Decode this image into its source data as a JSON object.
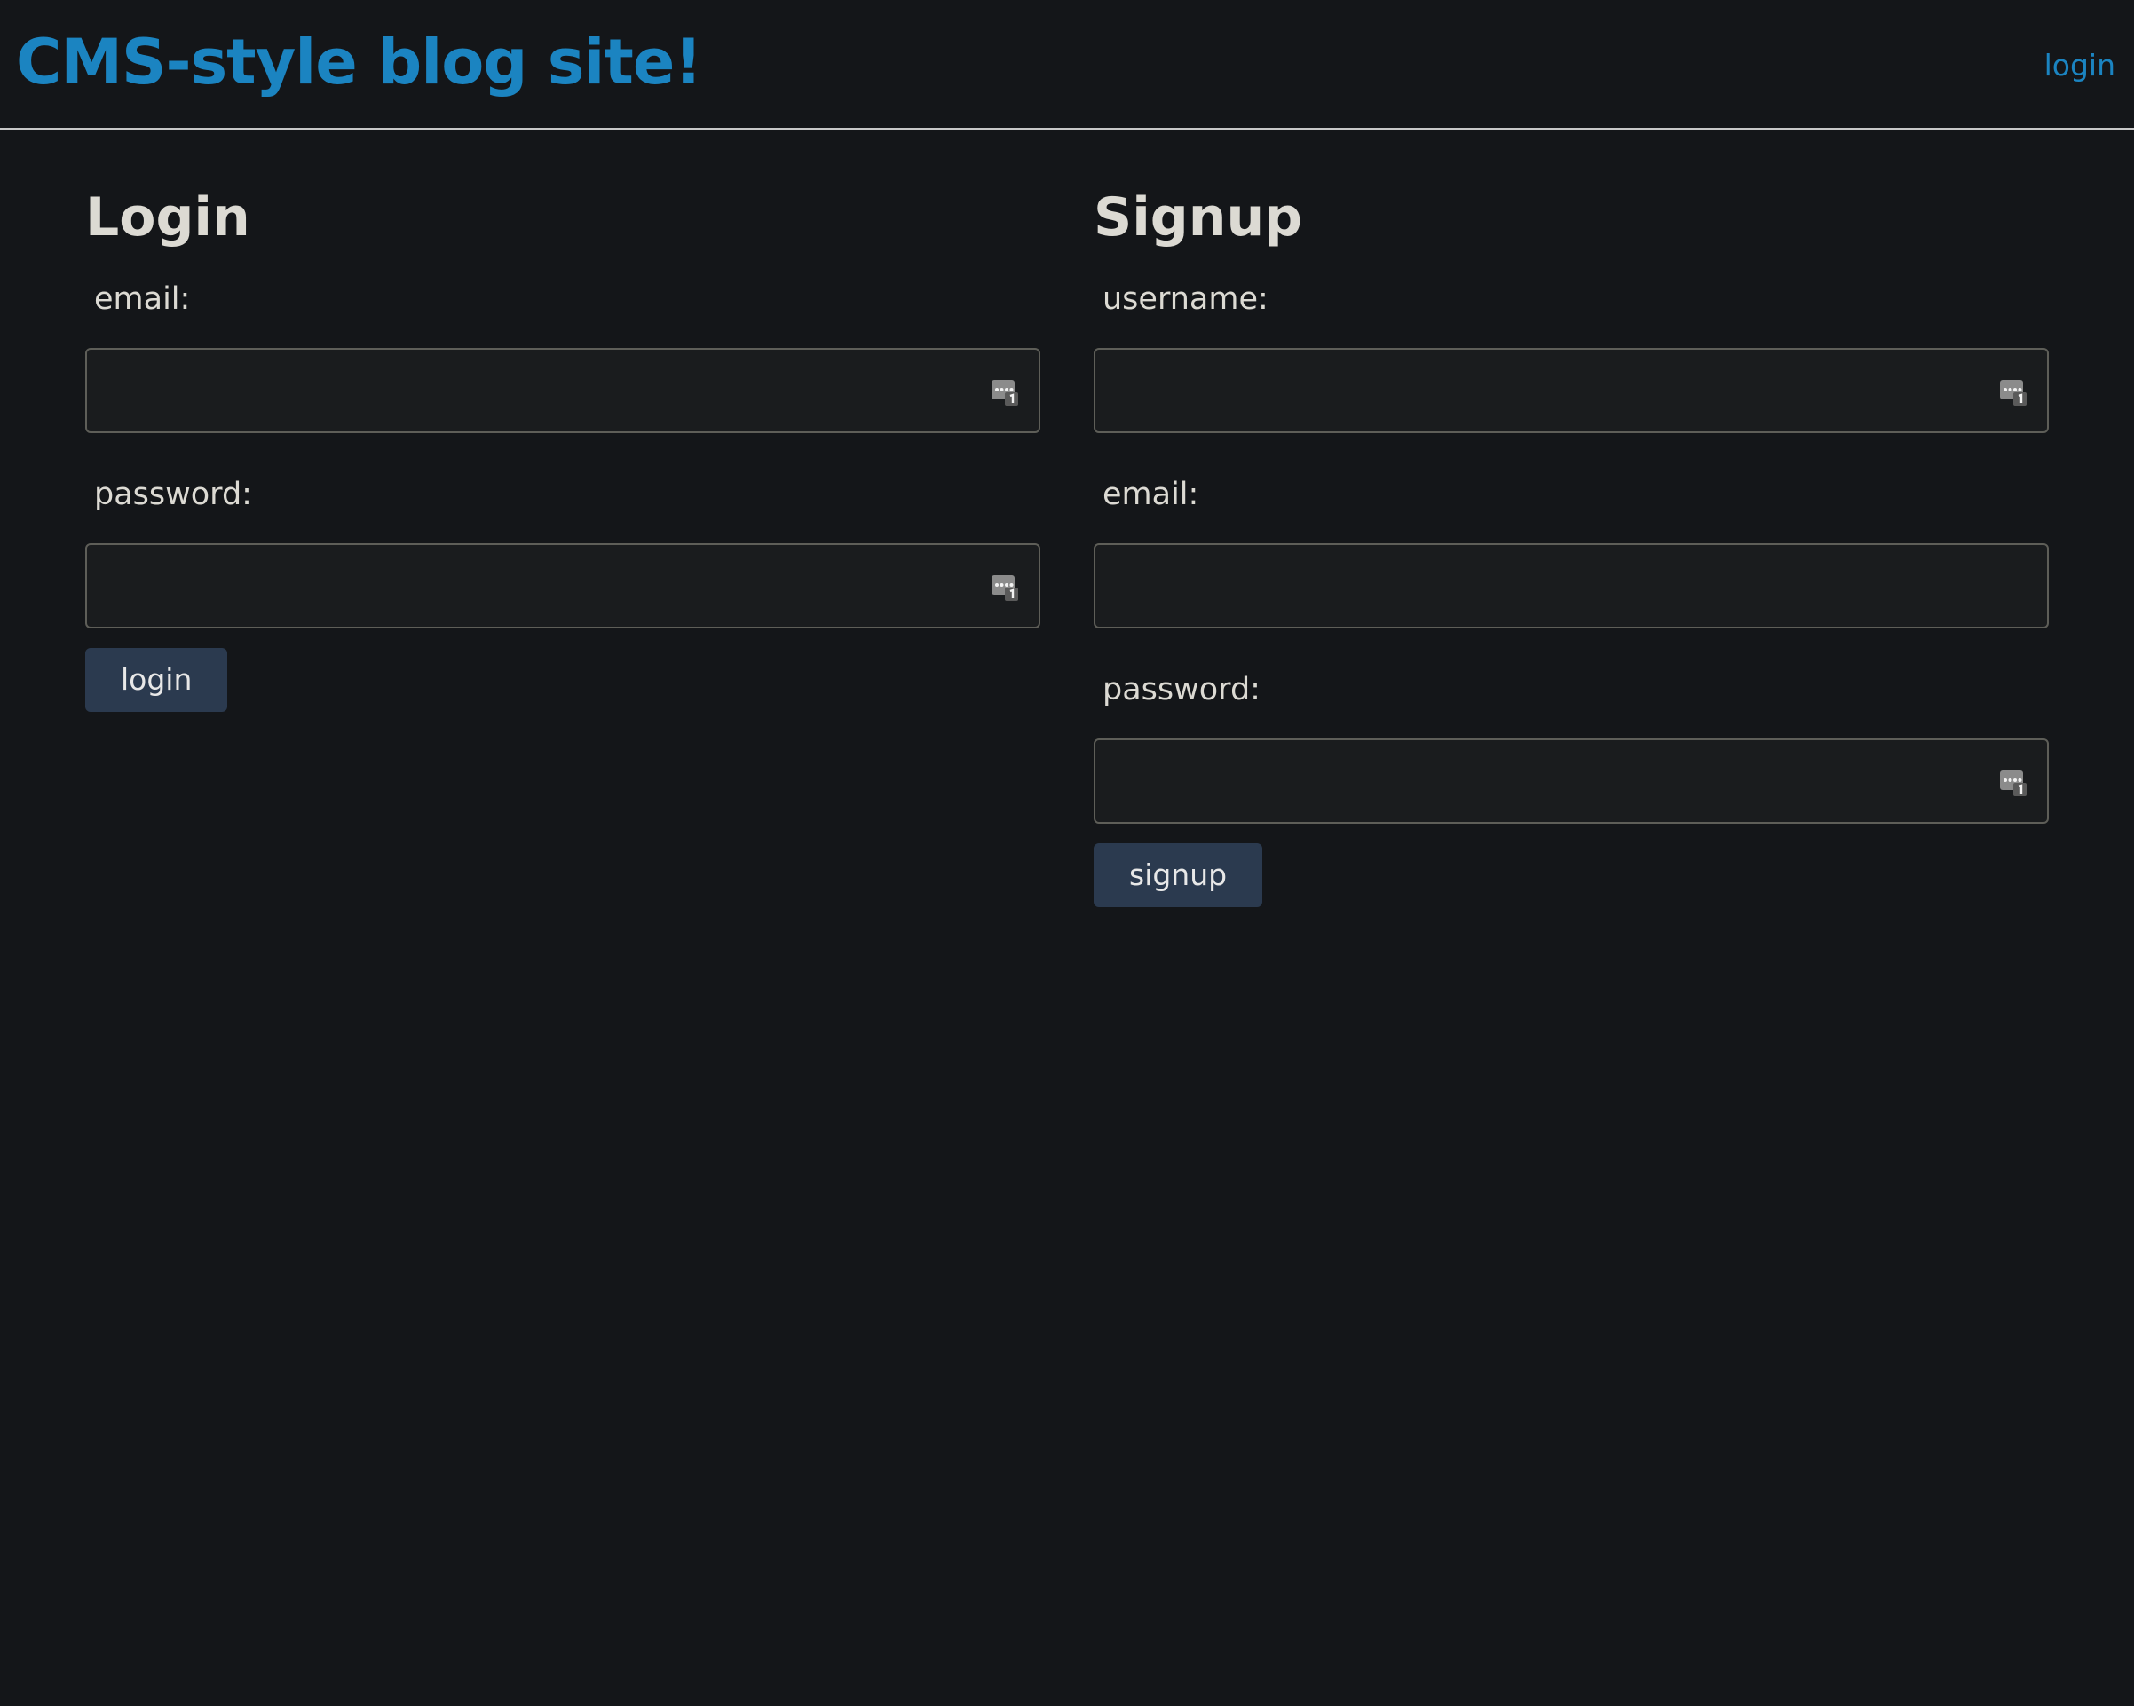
{
  "header": {
    "site_title": "CMS-style blog site!",
    "nav_login": "login"
  },
  "login_form": {
    "title": "Login",
    "email_label": "email:",
    "email_value": "",
    "password_label": "password:",
    "password_value": "",
    "submit_label": "login"
  },
  "signup_form": {
    "title": "Signup",
    "username_label": "username:",
    "username_value": "",
    "email_label": "email:",
    "email_value": "",
    "password_label": "password:",
    "password_value": "",
    "submit_label": "signup"
  },
  "colors": {
    "background": "#141619",
    "accent": "#1b84c1",
    "button": "#2b3a4f",
    "text": "#dcdad3"
  },
  "icons": {
    "field_autofill": "password-manager-icon"
  }
}
